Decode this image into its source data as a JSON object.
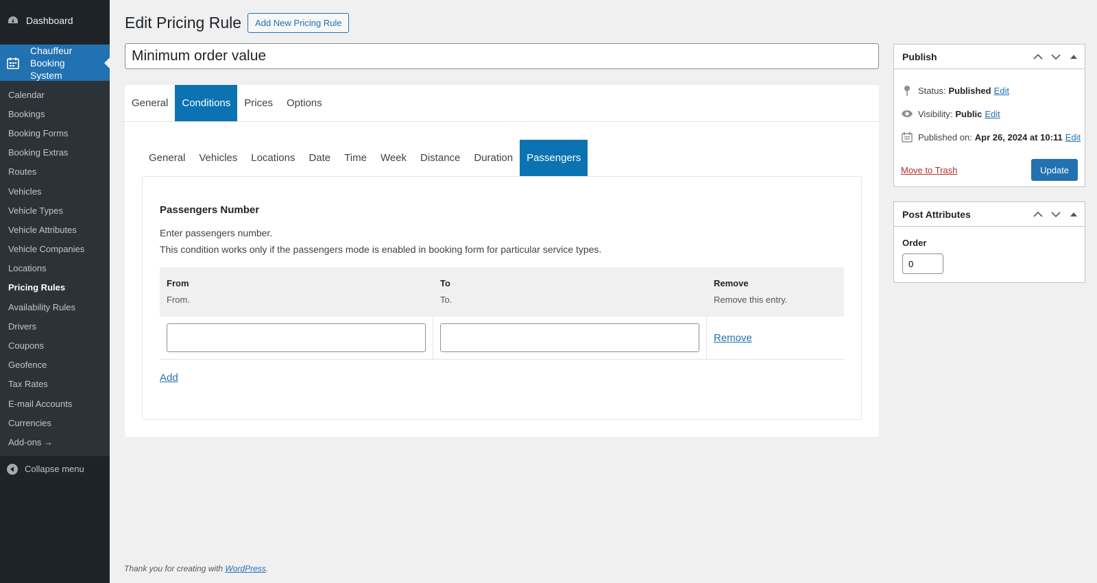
{
  "sidebar": {
    "dashboard_label": "Dashboard",
    "current_label": "Chauffeur Booking System",
    "items": [
      {
        "label": "Calendar"
      },
      {
        "label": "Bookings"
      },
      {
        "label": "Booking Forms"
      },
      {
        "label": "Booking Extras"
      },
      {
        "label": "Routes"
      },
      {
        "label": "Vehicles"
      },
      {
        "label": "Vehicle Types"
      },
      {
        "label": "Vehicle Attributes"
      },
      {
        "label": "Vehicle Companies"
      },
      {
        "label": "Locations"
      },
      {
        "label": "Pricing Rules",
        "active": true
      },
      {
        "label": "Availability Rules"
      },
      {
        "label": "Drivers"
      },
      {
        "label": "Coupons"
      },
      {
        "label": "Geofence"
      },
      {
        "label": "Tax Rates"
      },
      {
        "label": "E-mail Accounts"
      },
      {
        "label": "Currencies"
      },
      {
        "label": "Add-ons →"
      }
    ],
    "collapse_label": "Collapse menu"
  },
  "header": {
    "title": "Edit Pricing Rule",
    "add_new_label": "Add New Pricing Rule"
  },
  "post_title": "Minimum order value",
  "main_tabs": [
    {
      "label": "General"
    },
    {
      "label": "Conditions",
      "active": true
    },
    {
      "label": "Prices"
    },
    {
      "label": "Options"
    }
  ],
  "sub_tabs": [
    {
      "label": "General"
    },
    {
      "label": "Vehicles"
    },
    {
      "label": "Locations"
    },
    {
      "label": "Date"
    },
    {
      "label": "Time"
    },
    {
      "label": "Week"
    },
    {
      "label": "Distance"
    },
    {
      "label": "Duration"
    },
    {
      "label": "Passengers",
      "active": true
    }
  ],
  "passengers": {
    "title": "Passengers Number",
    "desc1": "Enter passengers number.",
    "desc2": "This condition works only if the passengers mode is enabled in booking form for particular service types.",
    "columns": [
      {
        "header": "From",
        "sub": "From."
      },
      {
        "header": "To",
        "sub": "To."
      },
      {
        "header": "Remove",
        "sub": "Remove this entry."
      }
    ],
    "row": {
      "from": "",
      "to": "",
      "remove_label": "Remove"
    },
    "add_label": "Add"
  },
  "publish": {
    "title": "Publish",
    "status_label": "Status:",
    "status_value": "Published",
    "visibility_label": "Visibility:",
    "visibility_value": "Public",
    "published_label": "Published on:",
    "published_value": "Apr 26, 2024 at 10:11",
    "edit_label": "Edit",
    "trash_label": "Move to Trash",
    "update_label": "Update"
  },
  "attributes": {
    "title": "Post Attributes",
    "order_label": "Order",
    "order_value": "0"
  },
  "footer": {
    "text": "Thank you for creating with",
    "link": "WordPress",
    "suffix": "."
  }
}
